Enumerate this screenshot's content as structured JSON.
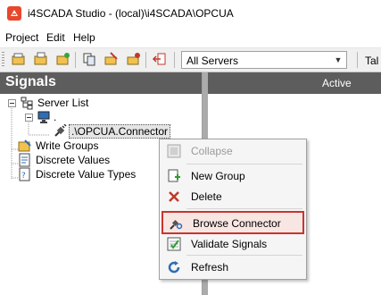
{
  "window": {
    "title": "i4SCADA Studio - (local)\\i4SCADA\\OPCUA"
  },
  "menu": {
    "items": [
      "Project",
      "Edit",
      "Help"
    ]
  },
  "toolbar": {
    "server_filter": "All Servers",
    "overflow_text": "Tal"
  },
  "signals_panel": {
    "title": "Signals",
    "tree": {
      "server_list": "Server List",
      "server_node": ".",
      "connector": ".\\OPCUA.Connector",
      "write_groups": "Write Groups",
      "discrete_values": "Discrete Values",
      "discrete_value_types": "Discrete Value Types"
    }
  },
  "right_panel": {
    "column_header": "Active"
  },
  "context_menu": {
    "items": [
      {
        "label": "Collapse",
        "icon": "collapse-icon",
        "enabled": false
      },
      {
        "label": "New Group",
        "icon": "new-group-icon",
        "enabled": true
      },
      {
        "label": "Delete",
        "icon": "delete-icon",
        "enabled": true
      },
      {
        "label": "Browse Connector",
        "icon": "browse-connector-icon",
        "enabled": true,
        "highlighted": true
      },
      {
        "label": "Validate Signals",
        "icon": "validate-icon",
        "enabled": true
      },
      {
        "label": "Refresh",
        "icon": "refresh-icon",
        "enabled": true
      }
    ],
    "highlight_color": "#c9342f"
  },
  "colors": {
    "panel_header": "#5d5d5d",
    "toolbar": "#f0f0f0",
    "accent": "#e8472b"
  }
}
